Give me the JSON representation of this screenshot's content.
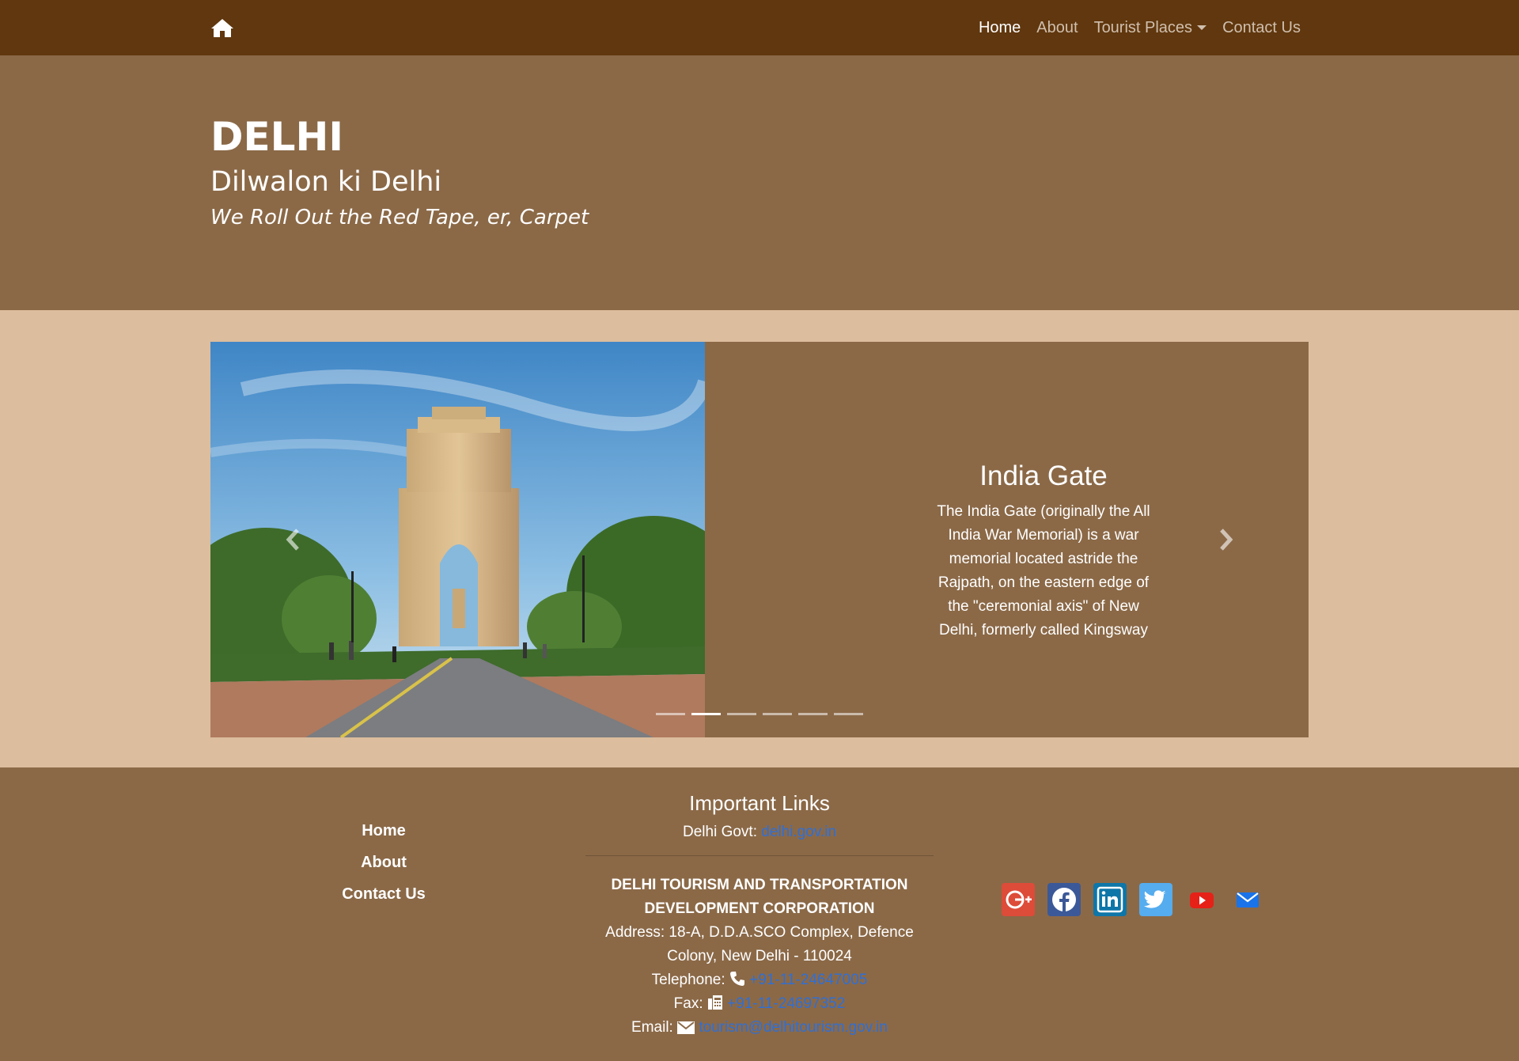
{
  "navbar": {
    "home_icon": "home-icon",
    "links": [
      {
        "label": "Home",
        "active": true
      },
      {
        "label": "About",
        "active": false
      },
      {
        "label": "Tourist Places",
        "active": false,
        "dropdown": true
      },
      {
        "label": "Contact Us",
        "active": false
      }
    ]
  },
  "header": {
    "title": "DELHI",
    "subtitle": "Dilwalon ki Delhi",
    "tagline": "We Roll Out the Red Tape, er, Carpet"
  },
  "carousel": {
    "active_index": 1,
    "slide_count": 6,
    "slide": {
      "image": "india-gate-photo",
      "title": "India Gate",
      "text": "The India Gate (originally the All India War Memorial) is a war memorial located astride the Rajpath, on the eastern edge of the \"ceremonial axis\" of New Delhi, formerly called Kingsway"
    }
  },
  "footer": {
    "nav": [
      "Home",
      "About",
      "Contact Us"
    ],
    "links_heading": "Important Links",
    "govt_label": "Delhi Govt:",
    "govt_link": "delhi.gov.in",
    "org_name": "DELHI TOURISM AND TRANSPORTATION DEVELOPMENT CORPORATION",
    "address": "Address: 18-A, D.D.A.SCO Complex, Defence Colony, New Delhi - 110024",
    "telephone_label": "Telephone:",
    "telephone": "+91-11-24647005",
    "fax_label": "Fax:",
    "fax": "+91-11-24697352",
    "email_label": "Email:",
    "email": "tourism@delhitourism.gov.in",
    "social": [
      "google-plus-icon",
      "facebook-icon",
      "linkedin-icon",
      "twitter-icon",
      "youtube-icon",
      "mail-icon"
    ]
  },
  "colors": {
    "navbar": "#60370e",
    "header": "#8b6947",
    "carousel_band": "#dcbd9d",
    "link": "#2f6fd6"
  }
}
